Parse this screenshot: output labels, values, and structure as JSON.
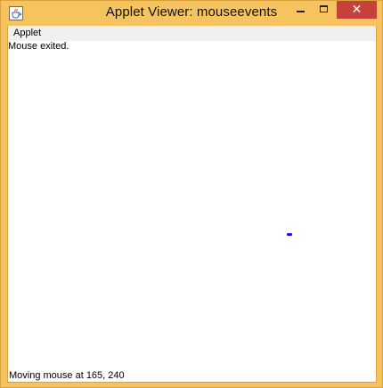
{
  "window": {
    "title": "Applet Viewer: mouseevents",
    "icon": "java-cup-icon",
    "controls": {
      "minimize": "minimize-icon",
      "maximize": "maximize-icon",
      "close_label": "✕"
    }
  },
  "menubar": {
    "items": [
      {
        "label": "Applet"
      }
    ]
  },
  "applet": {
    "message": "Mouse exited.",
    "status": "Moving mouse at 165, 240"
  },
  "colors": {
    "frame": "#f5c35f",
    "close": "#c7403a",
    "mark": "#1a1adf"
  }
}
